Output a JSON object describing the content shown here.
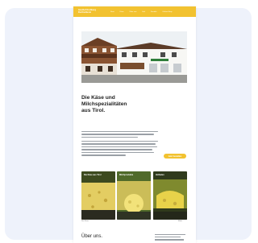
{
  "site": {
    "brand_line1": "Gasthof Krahberg",
    "brand_line2": "Dorfmolkerei",
    "nav": [
      "Start",
      "Käse",
      "Über uns",
      "Hof",
      "Kontakt",
      "Online-Shop"
    ],
    "hero_title_lines": [
      "Die Käse und",
      "Milchspezialitäten",
      "aus Tirol."
    ],
    "cta_label": "Jetzt bestellen",
    "cards": [
      {
        "title": "Die Käse aus Tirol",
        "accent": "#c8b13a"
      },
      {
        "title": "Milchprodukte",
        "accent": "#d9c43c"
      },
      {
        "title": "Hofladen",
        "accent": "#7f8a2e"
      }
    ],
    "captions": [
      "Die Käse",
      "Mehr"
    ],
    "about_title": "Über uns."
  },
  "colors": {
    "brand_yellow": "#f2c230",
    "canvas_bg": "#eef2fb"
  }
}
